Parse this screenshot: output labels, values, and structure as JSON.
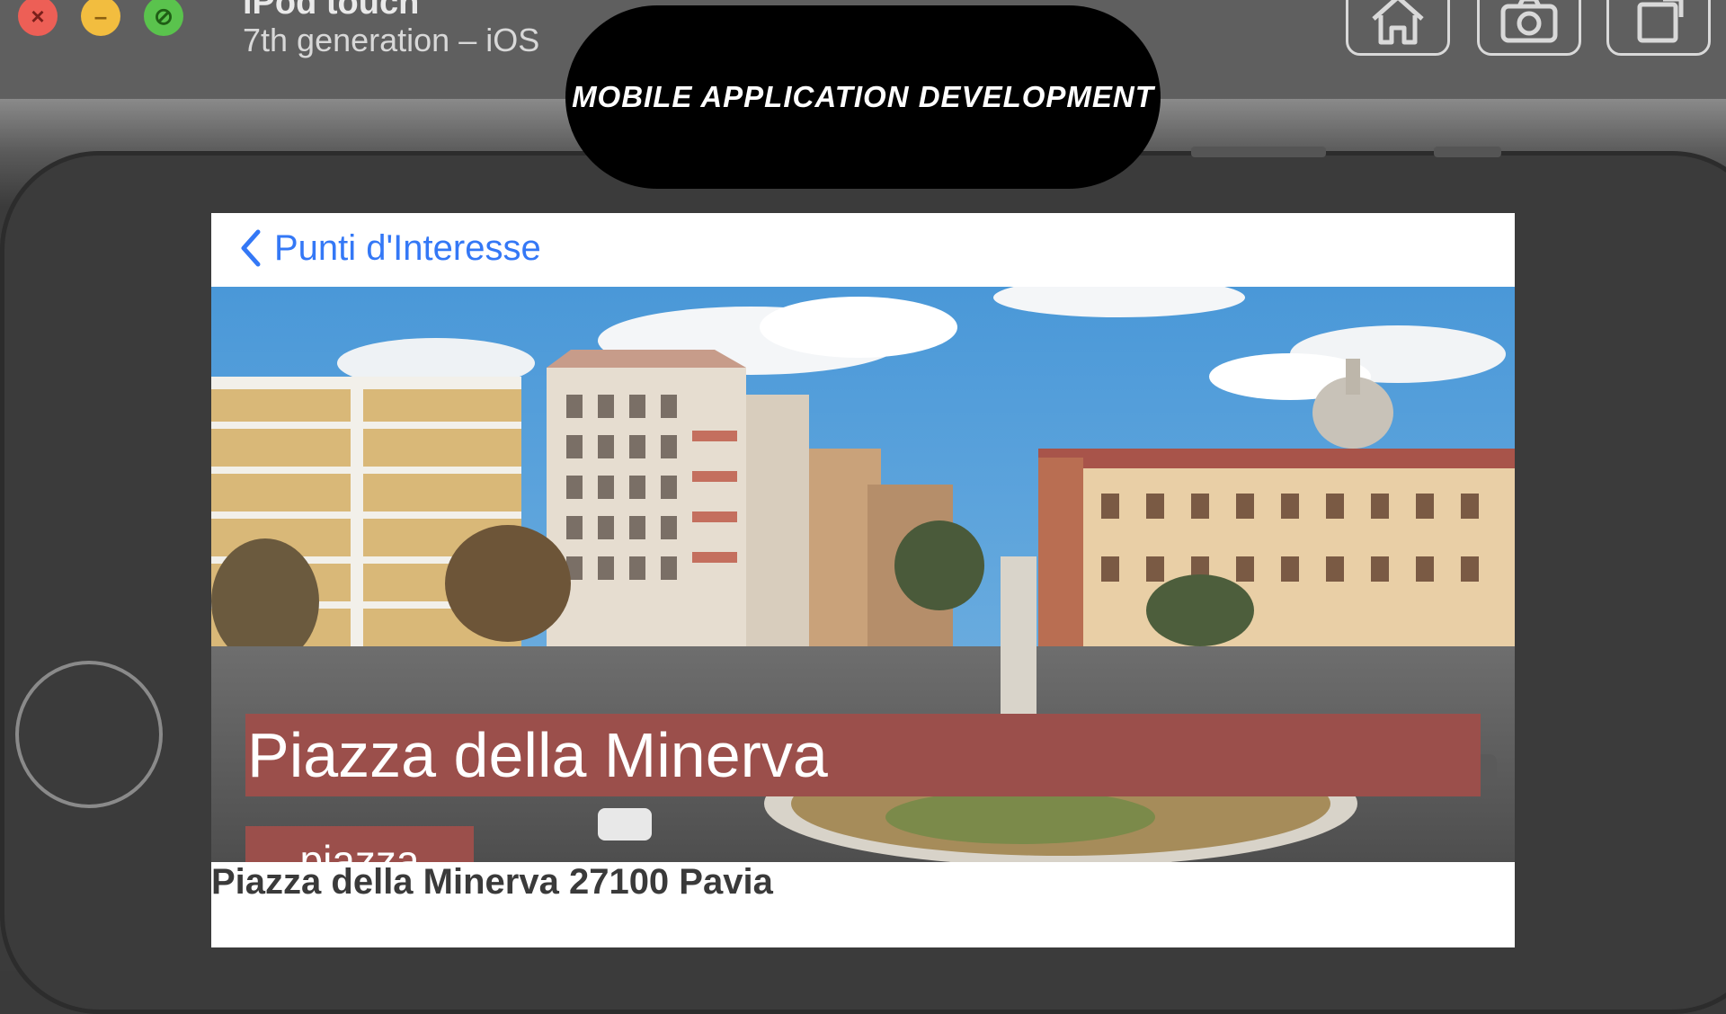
{
  "window": {
    "device_name": "iPod touch",
    "device_subtitle": "7th generation – iOS",
    "buttons": {
      "home": "home-icon",
      "screenshot": "camera-icon",
      "rotate": "rotate-icon"
    }
  },
  "overlay": {
    "caption": "MOBILE APPLICATION DEVELOPMENT"
  },
  "app": {
    "nav": {
      "back_label": "Punti d'Interesse"
    },
    "poi": {
      "title": "Piazza della Minerva",
      "category": "piazza",
      "address": "Piazza della Minerva 27100 Pavia"
    }
  },
  "colors": {
    "accent": "#3478f6",
    "label_background": "#9b4f4b",
    "close": "#ed5f56",
    "minimize": "#f2bd3f",
    "maximize": "#5ac34d"
  }
}
